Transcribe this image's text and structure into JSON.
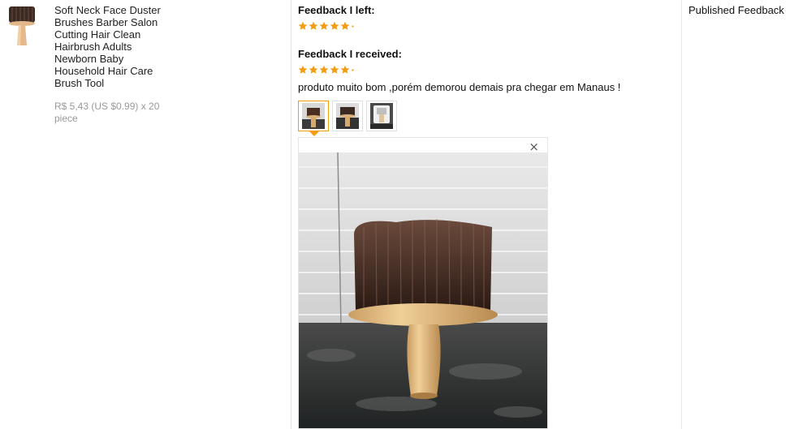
{
  "product": {
    "title": "Soft Neck Face Duster Brushes Barber Salon Cutting Hair Clean Hairbrush Adults Newborn Baby Household Hair Care Brush Tool",
    "price": "R$ 5,43 (US $0.99) x 20 piece",
    "thumbnail_icon": "brush-product-image"
  },
  "feedback": {
    "left_label": "Feedback I left:",
    "left_rating": 5,
    "received_label": "Feedback I received:",
    "received_rating": 5,
    "comment": "produto muito bom ,porém demorou demais pra chegar em Manaus !",
    "photos": [
      "photo-1",
      "photo-2",
      "photo-3"
    ],
    "selected_photo": 0,
    "close_glyph": "×"
  },
  "status": {
    "label": "Published Feedback"
  },
  "colors": {
    "star": "#f39c12",
    "active_thumb_border": "#f39c12",
    "divider": "#e8e8e8",
    "price_text": "#999999"
  }
}
